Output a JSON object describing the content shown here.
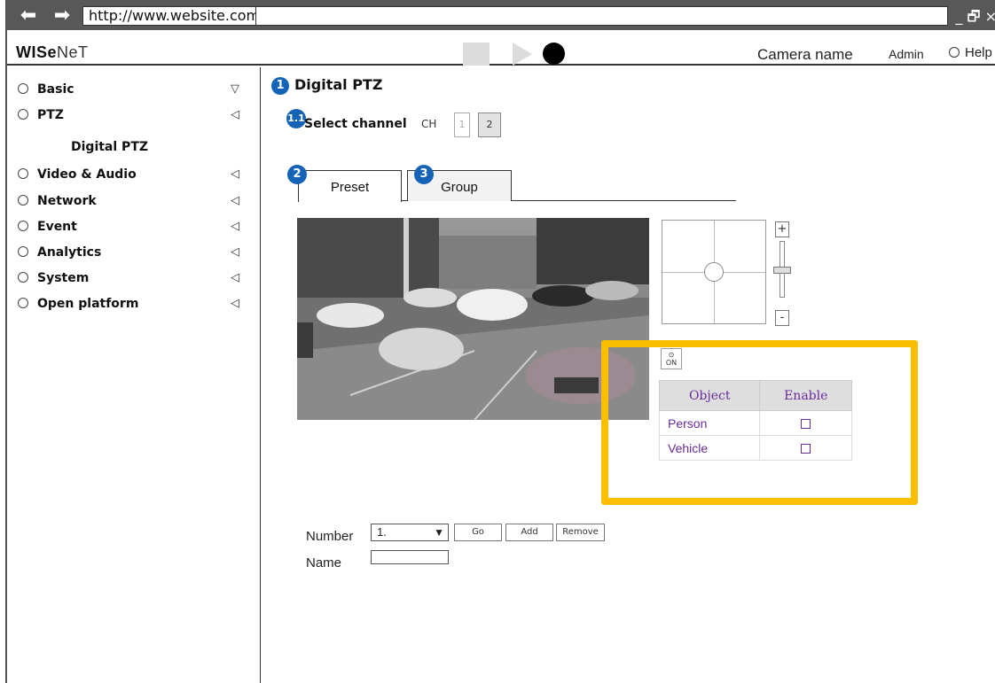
{
  "browser": {
    "back_glyph": "⬅",
    "forward_glyph": "➡",
    "url": "http://www.website.com/",
    "window_controls": "_ 🗗 ×"
  },
  "header": {
    "logo_bold": "WISe",
    "logo_rest": "NeT",
    "camera_name": "Camera name",
    "user": "Admin",
    "help": "Help"
  },
  "sidebar": {
    "items": [
      {
        "label": "Basic",
        "chevron": "▽"
      },
      {
        "label": "PTZ",
        "chevron": "◁"
      },
      {
        "label": "Video & Audio",
        "chevron": "◁"
      },
      {
        "label": "Network",
        "chevron": "◁"
      },
      {
        "label": "Event",
        "chevron": "◁"
      },
      {
        "label": "Analytics",
        "chevron": "◁"
      },
      {
        "label": "System",
        "chevron": "◁"
      },
      {
        "label": "Open platform",
        "chevron": "◁"
      }
    ],
    "sub_item": "Digital PTZ"
  },
  "main": {
    "title_badge": "1",
    "title": "Digital PTZ",
    "channel_badge": "1.1",
    "select_channel": "Select channel",
    "ch_label": "CH",
    "channels": [
      "1",
      "2"
    ],
    "tabs": [
      {
        "badge": "2",
        "label": "Preset"
      },
      {
        "badge": "3",
        "label": "Group"
      }
    ],
    "zoom_plus": "+",
    "zoom_minus": "-",
    "on_label": "ON",
    "table": {
      "headers": [
        "Object",
        "Enable"
      ],
      "rows": [
        "Person",
        "Vehicle"
      ]
    },
    "form": {
      "number_label": "Number",
      "number_value": "1.",
      "dropdown_glyph": "▼",
      "go": "Go",
      "add": "Add",
      "remove": "Remove",
      "name_label": "Name"
    }
  },
  "colors": {
    "badge_blue": "#1563b6",
    "highlight": "#fcbf00",
    "table_text": "#6a2b9a"
  }
}
